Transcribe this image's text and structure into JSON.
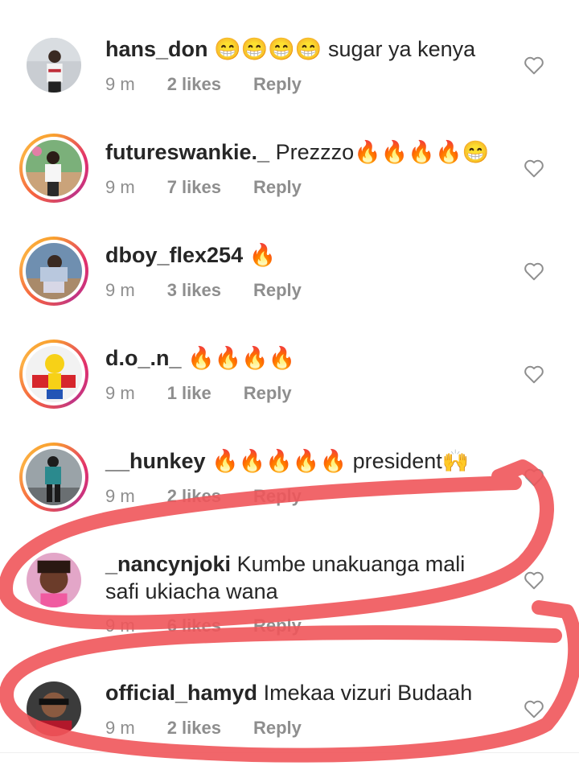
{
  "comments": [
    {
      "username": "hans_don",
      "text": "😁😁😁😁 sugar ya kenya",
      "time": "9 m",
      "likes": "2 likes",
      "reply": "Reply"
    },
    {
      "username": "futureswankie._",
      "text": "Prezzzo🔥🔥🔥🔥😁",
      "time": "9 m",
      "likes": "7 likes",
      "reply": "Reply"
    },
    {
      "username": "dboy_flex254",
      "text": "🔥",
      "time": "9 m",
      "likes": "3 likes",
      "reply": "Reply"
    },
    {
      "username": "d.o_.n_",
      "text": "🔥🔥🔥🔥",
      "time": "9 m",
      "likes": "1 like",
      "reply": "Reply"
    },
    {
      "username": "__hunkey",
      "text": "🔥🔥🔥🔥🔥 president🙌",
      "time": "9 m",
      "likes": "2 likes",
      "reply": "Reply"
    },
    {
      "username": "_nancynjoki",
      "text": "Kumbe unakuanga mali",
      "text2": "safi ukiacha wana",
      "time": "9 m",
      "likes": "6 likes",
      "reply": "Reply"
    },
    {
      "username": "official_hamyd",
      "text": "Imekaa vizuri Budaah",
      "time": "9 m",
      "likes": "2 likes",
      "reply": "Reply"
    }
  ],
  "colors": {
    "text": "#262626",
    "meta": "#8e8e8e",
    "annotation": "#f0555a"
  },
  "icons": {
    "like": "heart-outline-icon"
  }
}
